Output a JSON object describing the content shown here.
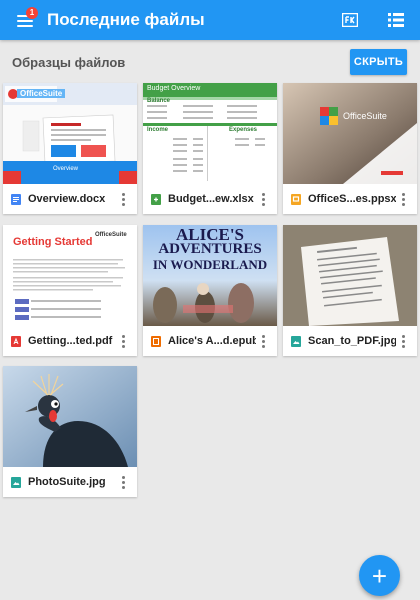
{
  "appbar": {
    "title": "Последние файлы",
    "badge": "1",
    "icons": [
      "menu-icon",
      "fk-icon",
      "list-view-icon"
    ]
  },
  "section": {
    "title": "Образцы файлов",
    "hide_label": "СКРЫТЬ"
  },
  "files": [
    {
      "name": "Overview.docx",
      "type": "docx",
      "icon": "doc-icon",
      "color": "#4285f4"
    },
    {
      "name": "Budget...ew.xlsx",
      "type": "xlsx",
      "icon": "sheet-icon",
      "color": "#43a047"
    },
    {
      "name": "OfficeS...es.ppsx",
      "type": "ppsx",
      "icon": "slides-icon",
      "color": "#f5a623"
    },
    {
      "name": "Getting...ted.pdf",
      "type": "pdf",
      "icon": "pdf-icon",
      "color": "#e53935"
    },
    {
      "name": "Alice's A...d.epub",
      "type": "epub",
      "icon": "book-icon",
      "color": "#ef6c00"
    },
    {
      "name": "Scan_to_PDF.jpg",
      "type": "jpg",
      "icon": "image-icon",
      "color": "#26a69a"
    },
    {
      "name": "PhotoSuite.jpg",
      "type": "jpg",
      "icon": "image-icon",
      "color": "#26a69a"
    }
  ],
  "thumbnails": {
    "overview": {
      "brand": "OfficeSuite",
      "caption": "Overview"
    },
    "budget": {
      "title": "Budget Overview",
      "section1": "Balance",
      "income": "Income",
      "expenses": "Expenses"
    },
    "officesuite": {
      "brand": "OfficeSuite"
    },
    "getting_started": {
      "title": "Getting Started",
      "brand": "OfficeSuite"
    },
    "alice": {
      "line1": "ALICE'S",
      "line2": "ADVENTURES",
      "line3": "IN WONDERLAND"
    }
  },
  "fab": {
    "label": "+",
    "icon": "add-icon"
  },
  "colors": {
    "accent": "#2196f3",
    "background": "#e9e9e9",
    "badge": "#f44336"
  }
}
